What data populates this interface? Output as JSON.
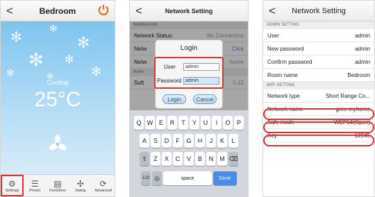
{
  "screen1": {
    "title": "Bedroom",
    "mode": "Cooling",
    "temperature": "25°C",
    "tabs": [
      {
        "label": "Settings",
        "icon": "gear-icon",
        "selected": true
      },
      {
        "label": "Preset",
        "icon": "list-icon",
        "selected": false
      },
      {
        "label": "Functions",
        "icon": "document-icon",
        "selected": false
      },
      {
        "label": "Swing",
        "icon": "swing-icon",
        "selected": false
      },
      {
        "label": "Advanced",
        "icon": "advanced-icon",
        "selected": false
      }
    ]
  },
  "screen2": {
    "title": "Network Setting",
    "section_label": "NetWork info",
    "status_label": "Network Status:",
    "status_value": "No Connection",
    "partial_rows": [
      "Netw",
      "Netw",
      "Norm",
      "Soft"
    ],
    "partial_values": [
      "Click",
      "home",
      "",
      "0.12"
    ],
    "dialog": {
      "title": "Login",
      "user_label": "User",
      "user_value": "admin",
      "password_label": "Password",
      "password_value": "admin",
      "login_button": "Login",
      "cancel_button": "Cancel"
    },
    "keyboard": {
      "row1": [
        "Q",
        "W",
        "E",
        "R",
        "T",
        "Y",
        "U",
        "I",
        "O",
        "P"
      ],
      "row2": [
        "A",
        "S",
        "D",
        "F",
        "G",
        "H",
        "J",
        "K",
        "L"
      ],
      "row3": [
        "Z",
        "X",
        "C",
        "V",
        "B",
        "N",
        "M"
      ],
      "numbers_key": "123",
      "space_key": "space",
      "done_key": "Done"
    }
  },
  "screen3": {
    "title": "Network Setting",
    "admin_section": "ADMIN SETTING",
    "admin_rows": [
      {
        "label": "User",
        "value": "admin"
      },
      {
        "label": "New password",
        "value": "admin"
      },
      {
        "label": "Confirm password",
        "value": "admin"
      },
      {
        "label": "Room name",
        "value": "Bedroom"
      }
    ],
    "wifi_section": "WIFI SETTING",
    "wifi_rows": [
      {
        "label": "Network type",
        "value": "Short Range Co..."
      },
      {
        "label": "Network name",
        "value": "gree-myhome"
      },
      {
        "label": "Safe mode",
        "value": "WEP64(Open)"
      },
      {
        "label": "Key",
        "value": "12345"
      }
    ]
  },
  "colors": {
    "highlight": "#e03030",
    "power": "#ef6a23",
    "sky": "#7ec4ef"
  }
}
